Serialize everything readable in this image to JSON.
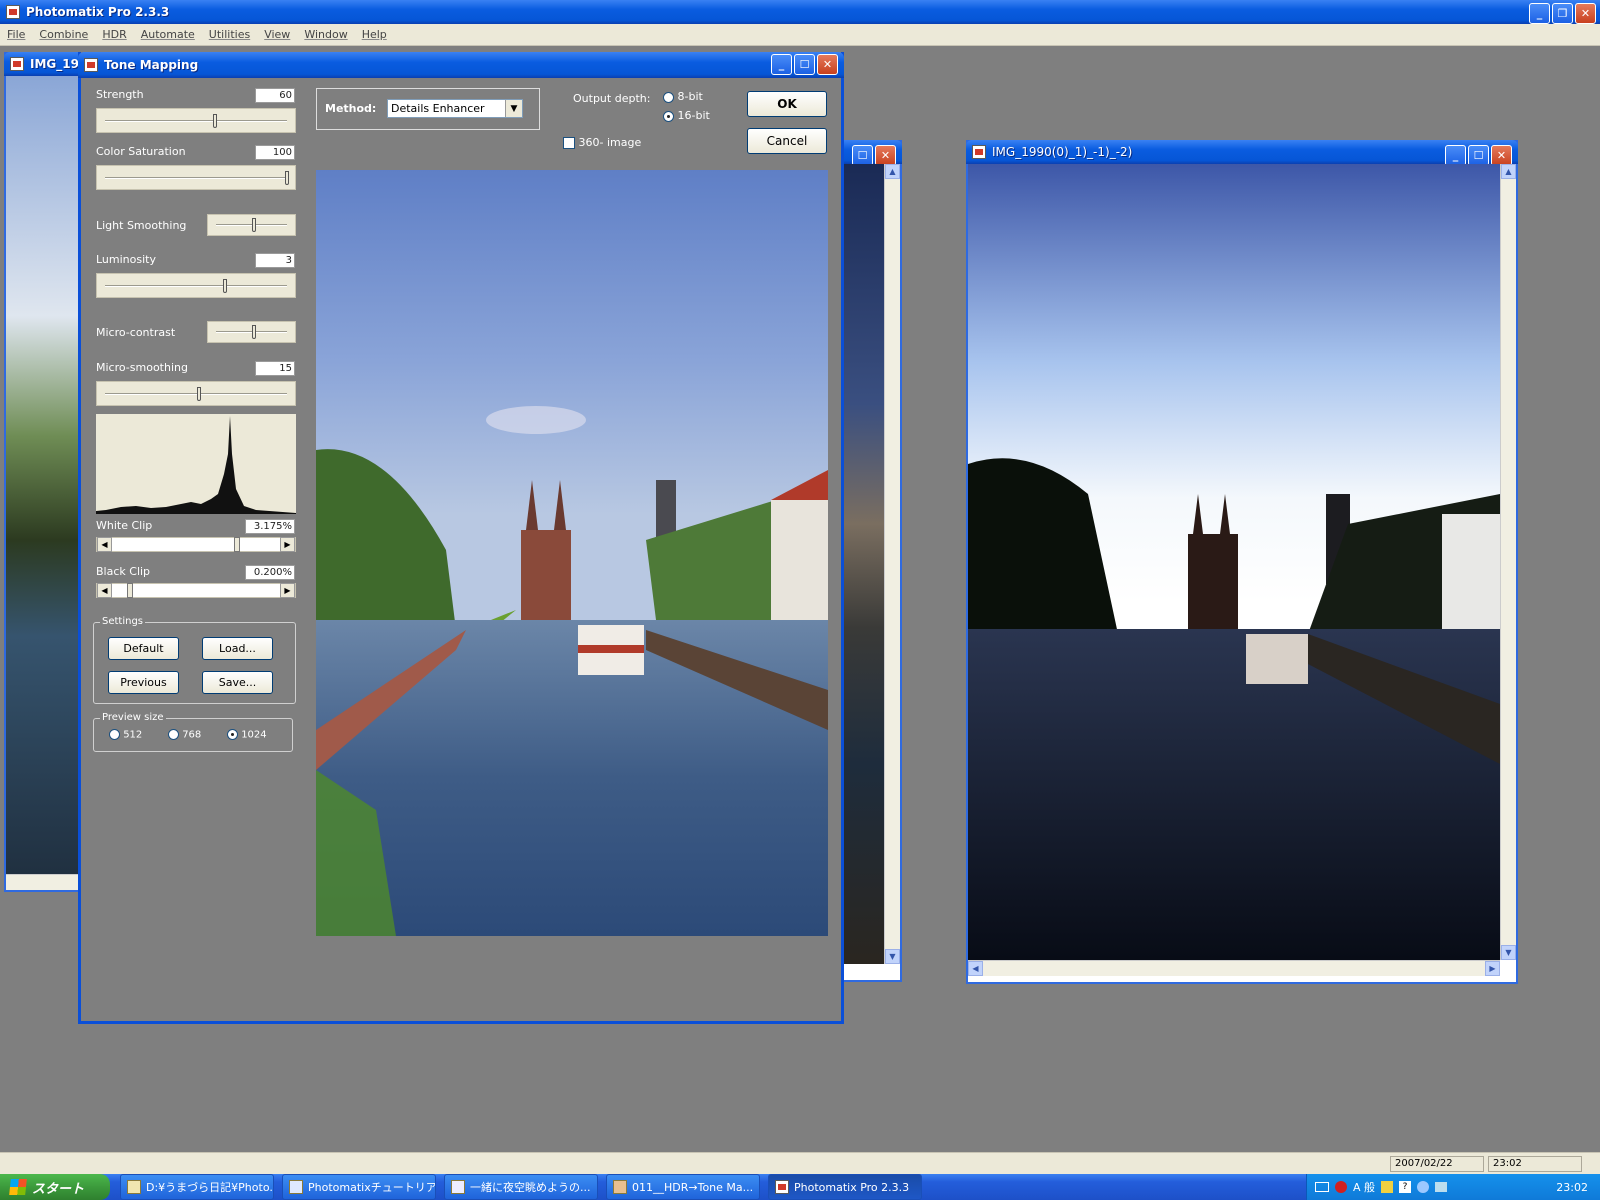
{
  "app": {
    "title": "Photomatix Pro 2.3.3",
    "menu": [
      "File",
      "Combine",
      "HDR",
      "Automate",
      "Utilities",
      "View",
      "Window",
      "Help"
    ]
  },
  "bg_window": {
    "title": "IMG_19"
  },
  "right_window": {
    "title": "IMG_1990(0)_1)_-1)_-2)"
  },
  "dialog": {
    "title": "Tone Mapping",
    "strength": {
      "label": "Strength",
      "value": "60",
      "level": 0.6
    },
    "color_saturation": {
      "label": "Color Saturation",
      "value": "100",
      "level": 1.0
    },
    "light_smoothing": {
      "label": "Light Smoothing"
    },
    "luminosity": {
      "label": "Luminosity",
      "value": "3",
      "level": 0.62
    },
    "micro_contrast": {
      "label": "Micro-contrast"
    },
    "micro_smoothing": {
      "label": "Micro-smoothing",
      "value": "15",
      "level": 0.5
    },
    "white_clip": {
      "label": "White Clip",
      "value": "3.175%"
    },
    "black_clip": {
      "label": "Black Clip",
      "value": "0.200%"
    },
    "settings": {
      "caption": "Settings",
      "default": "Default",
      "load": "Load...",
      "previous": "Previous",
      "save": "Save..."
    },
    "preview_size": {
      "caption": "Preview size",
      "options": [
        "512",
        "768",
        "1024"
      ],
      "selected": "1024"
    },
    "method": {
      "label": "Method:",
      "value": "Details Enhancer"
    },
    "output_depth": {
      "label": "Output depth:",
      "opt8": "8-bit",
      "opt16": "16-bit",
      "selected": "16-bit"
    },
    "image360": {
      "label": "360- image",
      "checked": false
    },
    "ok": "OK",
    "cancel": "Cancel"
  },
  "statusbar": {
    "date": "2007/02/22",
    "time": "23:02"
  },
  "taskbar": {
    "start": "スタート",
    "items": [
      "D:¥うまづら日記¥Photo...",
      "Photomatixチュートリア...",
      "一緒に夜空眺めようの...",
      "011__HDR→Tone Ma...",
      "Photomatix Pro 2.3.3"
    ],
    "tray_ime": "A 般",
    "clock": "23:02"
  },
  "colors": {
    "xp_blue": "#0a5ce0",
    "workspace": "#7f7f7f",
    "dialog_bg": "#7f7f7f",
    "taskbar": "#245edb",
    "start": "#3c9a3c"
  }
}
